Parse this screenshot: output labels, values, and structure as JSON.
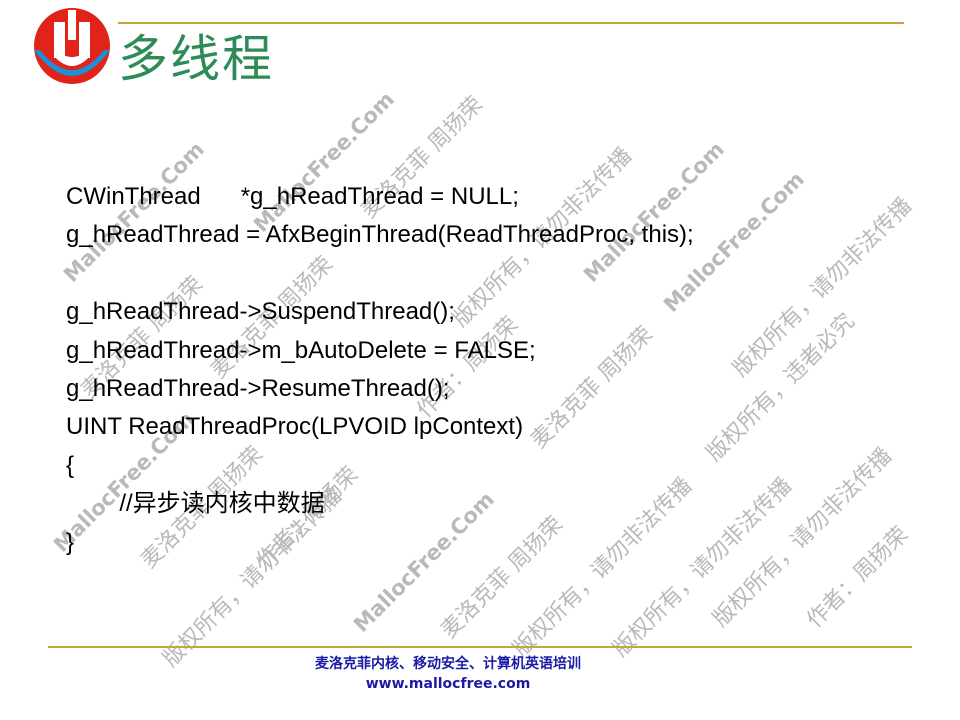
{
  "colors": {
    "title": "#2e8b57",
    "rule": "#c8a43c",
    "footer": "#1a1aa6",
    "logo_red": "#e2231a",
    "logo_blue": "#1e90d6"
  },
  "logo": {
    "icon": "mallocfree-logo-icon"
  },
  "title": "多线程",
  "code_lines": [
    "CWinThread      *g_hReadThread = NULL;",
    "g_hReadThread = AfxBeginThread(ReadThreadProc, this);",
    "",
    "g_hReadThread->SuspendThread();",
    "g_hReadThread->m_bAutoDelete = FALSE;",
    "g_hReadThread->ResumeThread();",
    "UINT ReadThreadProc(LPVOID lpContext)",
    "{",
    "\t\t//异步读内核中数据",
    "}"
  ],
  "footer": {
    "line1": "麦洛克菲内核、移动安全、计算机英语培训",
    "line2": "www.mallocfree.com"
  },
  "watermark": {
    "site": "MallocFree.Com",
    "author": "麦洛克菲 周扬荣",
    "author_title": "作者：周扬荣",
    "rights": "版权所有，请勿非法传播",
    "rights_short": "版权所有，违者必究"
  }
}
